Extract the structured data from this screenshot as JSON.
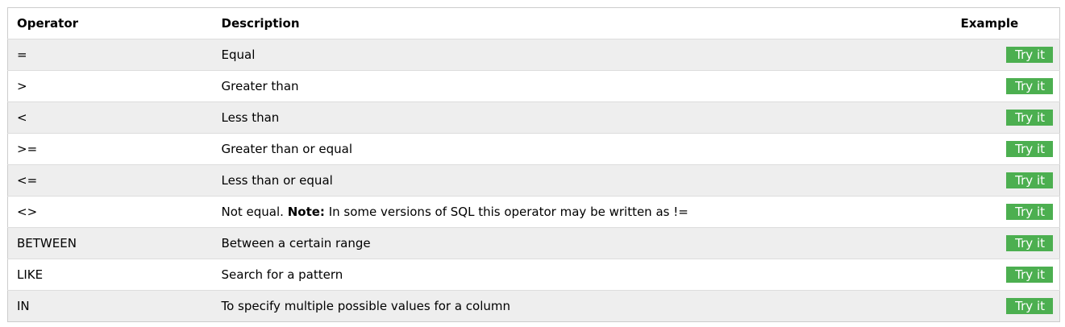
{
  "headers": {
    "operator": "Operator",
    "description": "Description",
    "example": "Example"
  },
  "rows": [
    {
      "operator": "=",
      "description": "Equal",
      "button": "Try it"
    },
    {
      "operator": ">",
      "description": "Greater than",
      "button": "Try it"
    },
    {
      "operator": "<",
      "description": "Less than",
      "button": "Try it"
    },
    {
      "operator": ">=",
      "description": "Greater than or equal",
      "button": "Try it"
    },
    {
      "operator": "<=",
      "description": "Less than or equal",
      "button": "Try it"
    },
    {
      "operator": "<>",
      "description": "Not equal.",
      "note_label": "Note:",
      "note_text": "In some versions of SQL this operator may be written as !=",
      "button": "Try it"
    },
    {
      "operator": "BETWEEN",
      "description": "Between a certain range",
      "button": "Try it"
    },
    {
      "operator": "LIKE",
      "description": "Search for a pattern",
      "button": "Try it"
    },
    {
      "operator": "IN",
      "description": "To specify multiple possible values for a column",
      "button": "Try it"
    }
  ],
  "colors": {
    "button_bg": "#4caf50",
    "button_text": "#ffffff",
    "row_alt": "#eeeeee",
    "border": "#dddddd"
  }
}
